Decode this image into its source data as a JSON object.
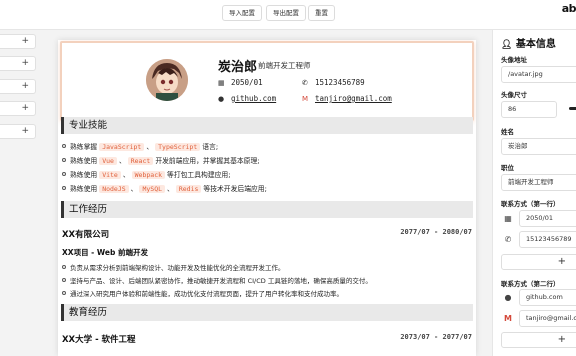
{
  "toolbar": {
    "import_label": "导入配置",
    "export_label": "导出配置",
    "reset_label": "重置"
  },
  "brand": {
    "text": "ab"
  },
  "left_panel": {
    "items": [
      "+",
      "+",
      "+",
      "+",
      "+"
    ]
  },
  "resume": {
    "name": "炭治郎",
    "title": "前端开发工程师",
    "birth": "2050/01",
    "phone": "15123456789",
    "github": "github.com",
    "email": "tanjiro@gmail.com",
    "sections": {
      "skills": "专业技能",
      "work": "工作经历",
      "edu": "教育经历"
    },
    "skills": [
      {
        "pre": "熟练掌握",
        "tags": [
          "JavaScript",
          "TypeScript"
        ],
        "post": "语言;"
      },
      {
        "pre": "熟练使用",
        "tags": [
          "Vue",
          "React"
        ],
        "post": "开发前端应用，并掌握其基本原理;"
      },
      {
        "pre": "熟练使用",
        "tags": [
          "Vite",
          "Webpack"
        ],
        "post": "等打包工具构建应用;"
      },
      {
        "pre": "熟练使用",
        "tags": [
          "NodeJS",
          "MySQL",
          "Redis"
        ],
        "post": "等技术开发后端应用;"
      }
    ],
    "work": {
      "company": "XX有限公司",
      "date": "2077/07 - 2080/07",
      "project": "XX项目 - Web 前端开发",
      "details": [
        "负责从需求分析到前端架构设计、功能开发及性能优化的全流程开发工作。",
        "坚持与产品、设计、后端团队紧密协作，推动敏捷开发流程和 CI/CD 工具链的落地，确保高质量的交付。",
        "通过深入研究用户体验和前端性能，成功优化支付流程页面，提升了用户转化率和支付成功率。"
      ]
    },
    "edu": {
      "school": "XX大学 - 软件工程",
      "date": "2073/07 - 2077/07"
    }
  },
  "panel": {
    "title": "基本信息",
    "avatar_label": "头像地址",
    "avatar_value": "/avatar.jpg",
    "size_label": "头像尺寸",
    "size_value": "86",
    "name_label": "姓名",
    "name_value": "炭治郎",
    "job_label": "职位",
    "job_value": "前端开发工程师",
    "contact1_label": "联系方式（第一行）",
    "contact1": [
      "2050/01",
      "15123456789"
    ],
    "contact2_label": "联系方式（第二行）",
    "contact2": [
      "github.com",
      "tanjiro@gmail.com"
    ],
    "plus": "+"
  },
  "colors": {
    "accent": "#e0613c",
    "tag_bg": "#fde8e0",
    "header_border": "#f3d1bd"
  }
}
